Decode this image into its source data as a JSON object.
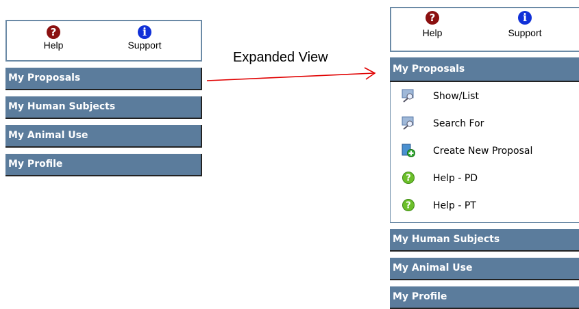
{
  "caption": "Expanded View",
  "helpbox": {
    "help_label": "Help",
    "support_label": "Support",
    "help_icon_glyph": "?",
    "support_icon_glyph": "i"
  },
  "collapsed": {
    "sections": [
      {
        "label": "My Proposals"
      },
      {
        "label": "My Human Subjects"
      },
      {
        "label": "My Animal Use"
      },
      {
        "label": "My Profile"
      }
    ]
  },
  "expanded": {
    "open_section": "My Proposals",
    "items": [
      {
        "label": "Show/List",
        "icon": "magnifier-icon"
      },
      {
        "label": "Search For",
        "icon": "magnifier-icon"
      },
      {
        "label": "Create New Proposal",
        "icon": "new-document-icon"
      },
      {
        "label": "Help - PD",
        "icon": "green-help-icon"
      },
      {
        "label": "Help - PT",
        "icon": "green-help-icon"
      }
    ],
    "sections_below": [
      {
        "label": "My Human Subjects"
      },
      {
        "label": "My Animal Use"
      },
      {
        "label": "My Profile"
      }
    ]
  },
  "colors": {
    "header_bg": "#5b7c9c",
    "help_icon": "#8b1010",
    "info_icon": "#1030d8",
    "arrow": "#e00000"
  }
}
